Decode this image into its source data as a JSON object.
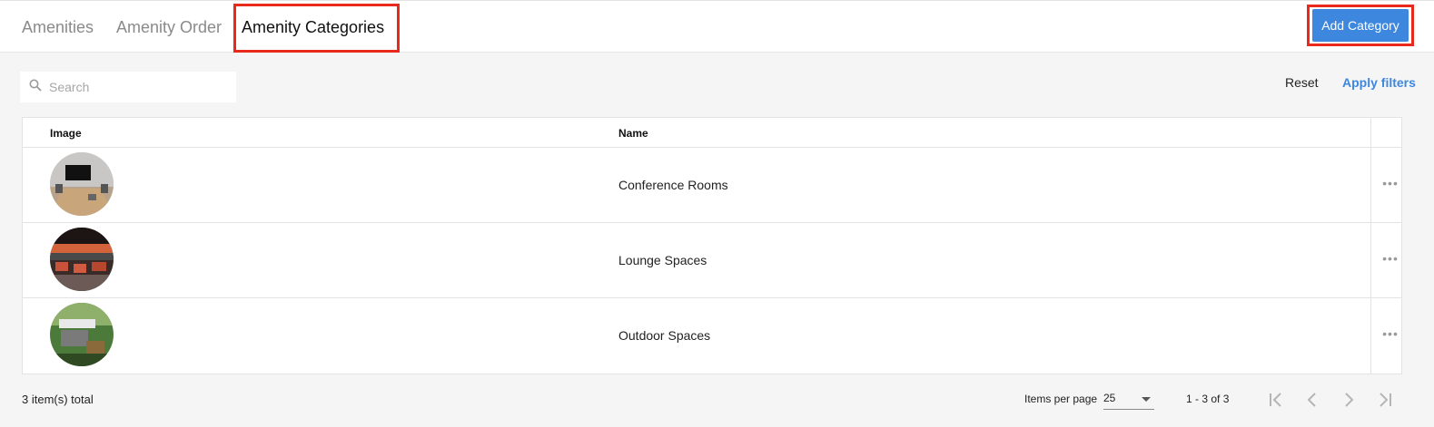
{
  "tabs": [
    {
      "label": "Amenities",
      "active": false
    },
    {
      "label": "Amenity Order",
      "active": false
    },
    {
      "label": "Amenity Categories",
      "active": true
    }
  ],
  "header": {
    "add_button_label": "Add Category"
  },
  "filters": {
    "search_placeholder": "Search",
    "reset_label": "Reset",
    "apply_label": "Apply filters"
  },
  "table": {
    "columns": [
      "Image",
      "Name"
    ],
    "rows": [
      {
        "name": "Conference Rooms",
        "image_icon": "conference-room-photo"
      },
      {
        "name": "Lounge Spaces",
        "image_icon": "lounge-photo"
      },
      {
        "name": "Outdoor Spaces",
        "image_icon": "outdoor-photo"
      }
    ],
    "row_menu_glyph": "•••"
  },
  "footer": {
    "total_text": "3 item(s) total",
    "items_per_page_label": "Items per page",
    "items_per_page_value": "25",
    "range_text": "1 - 3 of 3"
  },
  "colors": {
    "accent": "#3d87df",
    "highlight": "#e8291c"
  }
}
